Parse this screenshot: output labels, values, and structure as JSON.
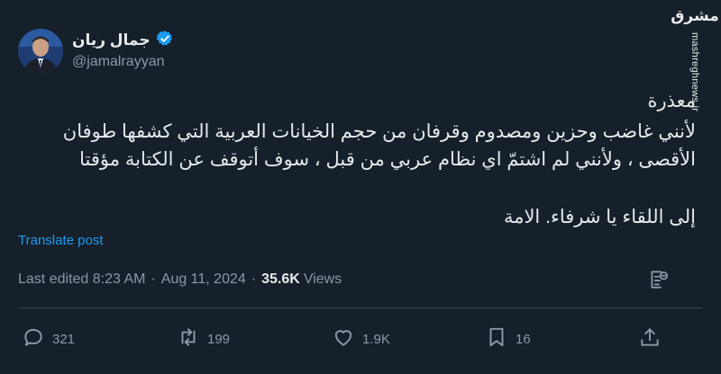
{
  "user": {
    "display_name": "جمال ريان",
    "handle": "@jamalrayyan"
  },
  "watermark": {
    "logo_text": "مشرق",
    "url": "mashreghnews.ir"
  },
  "tweet": {
    "lines": [
      "معذرة",
      "لأنني غاضب وحزين ومصدوم وقرفان من حجم الخيانات العربية التي كشفها طوفان",
      "الأقصى ، ولأنني لم اشتمّ اي نظام عربي من قبل ، سوف أتوقف عن الكتابة مؤقتا",
      "إلى اللقاء يا شرفاء. الامة"
    ],
    "translate_label": "Translate post"
  },
  "meta": {
    "edited_label": "Last edited",
    "time": "8:23 AM",
    "date": "Aug 11, 2024",
    "views_count": "35.6K",
    "views_label": "Views",
    "separator": "·"
  },
  "actions": {
    "replies": "321",
    "reposts": "199",
    "likes": "1.9K",
    "bookmarks": "16"
  },
  "colors": {
    "background": "#15202b",
    "text": "#e7e9ea",
    "secondary": "#8b98a5",
    "link": "#1d9bf0",
    "verified": "#1d9bf0",
    "divider": "#38444d"
  }
}
